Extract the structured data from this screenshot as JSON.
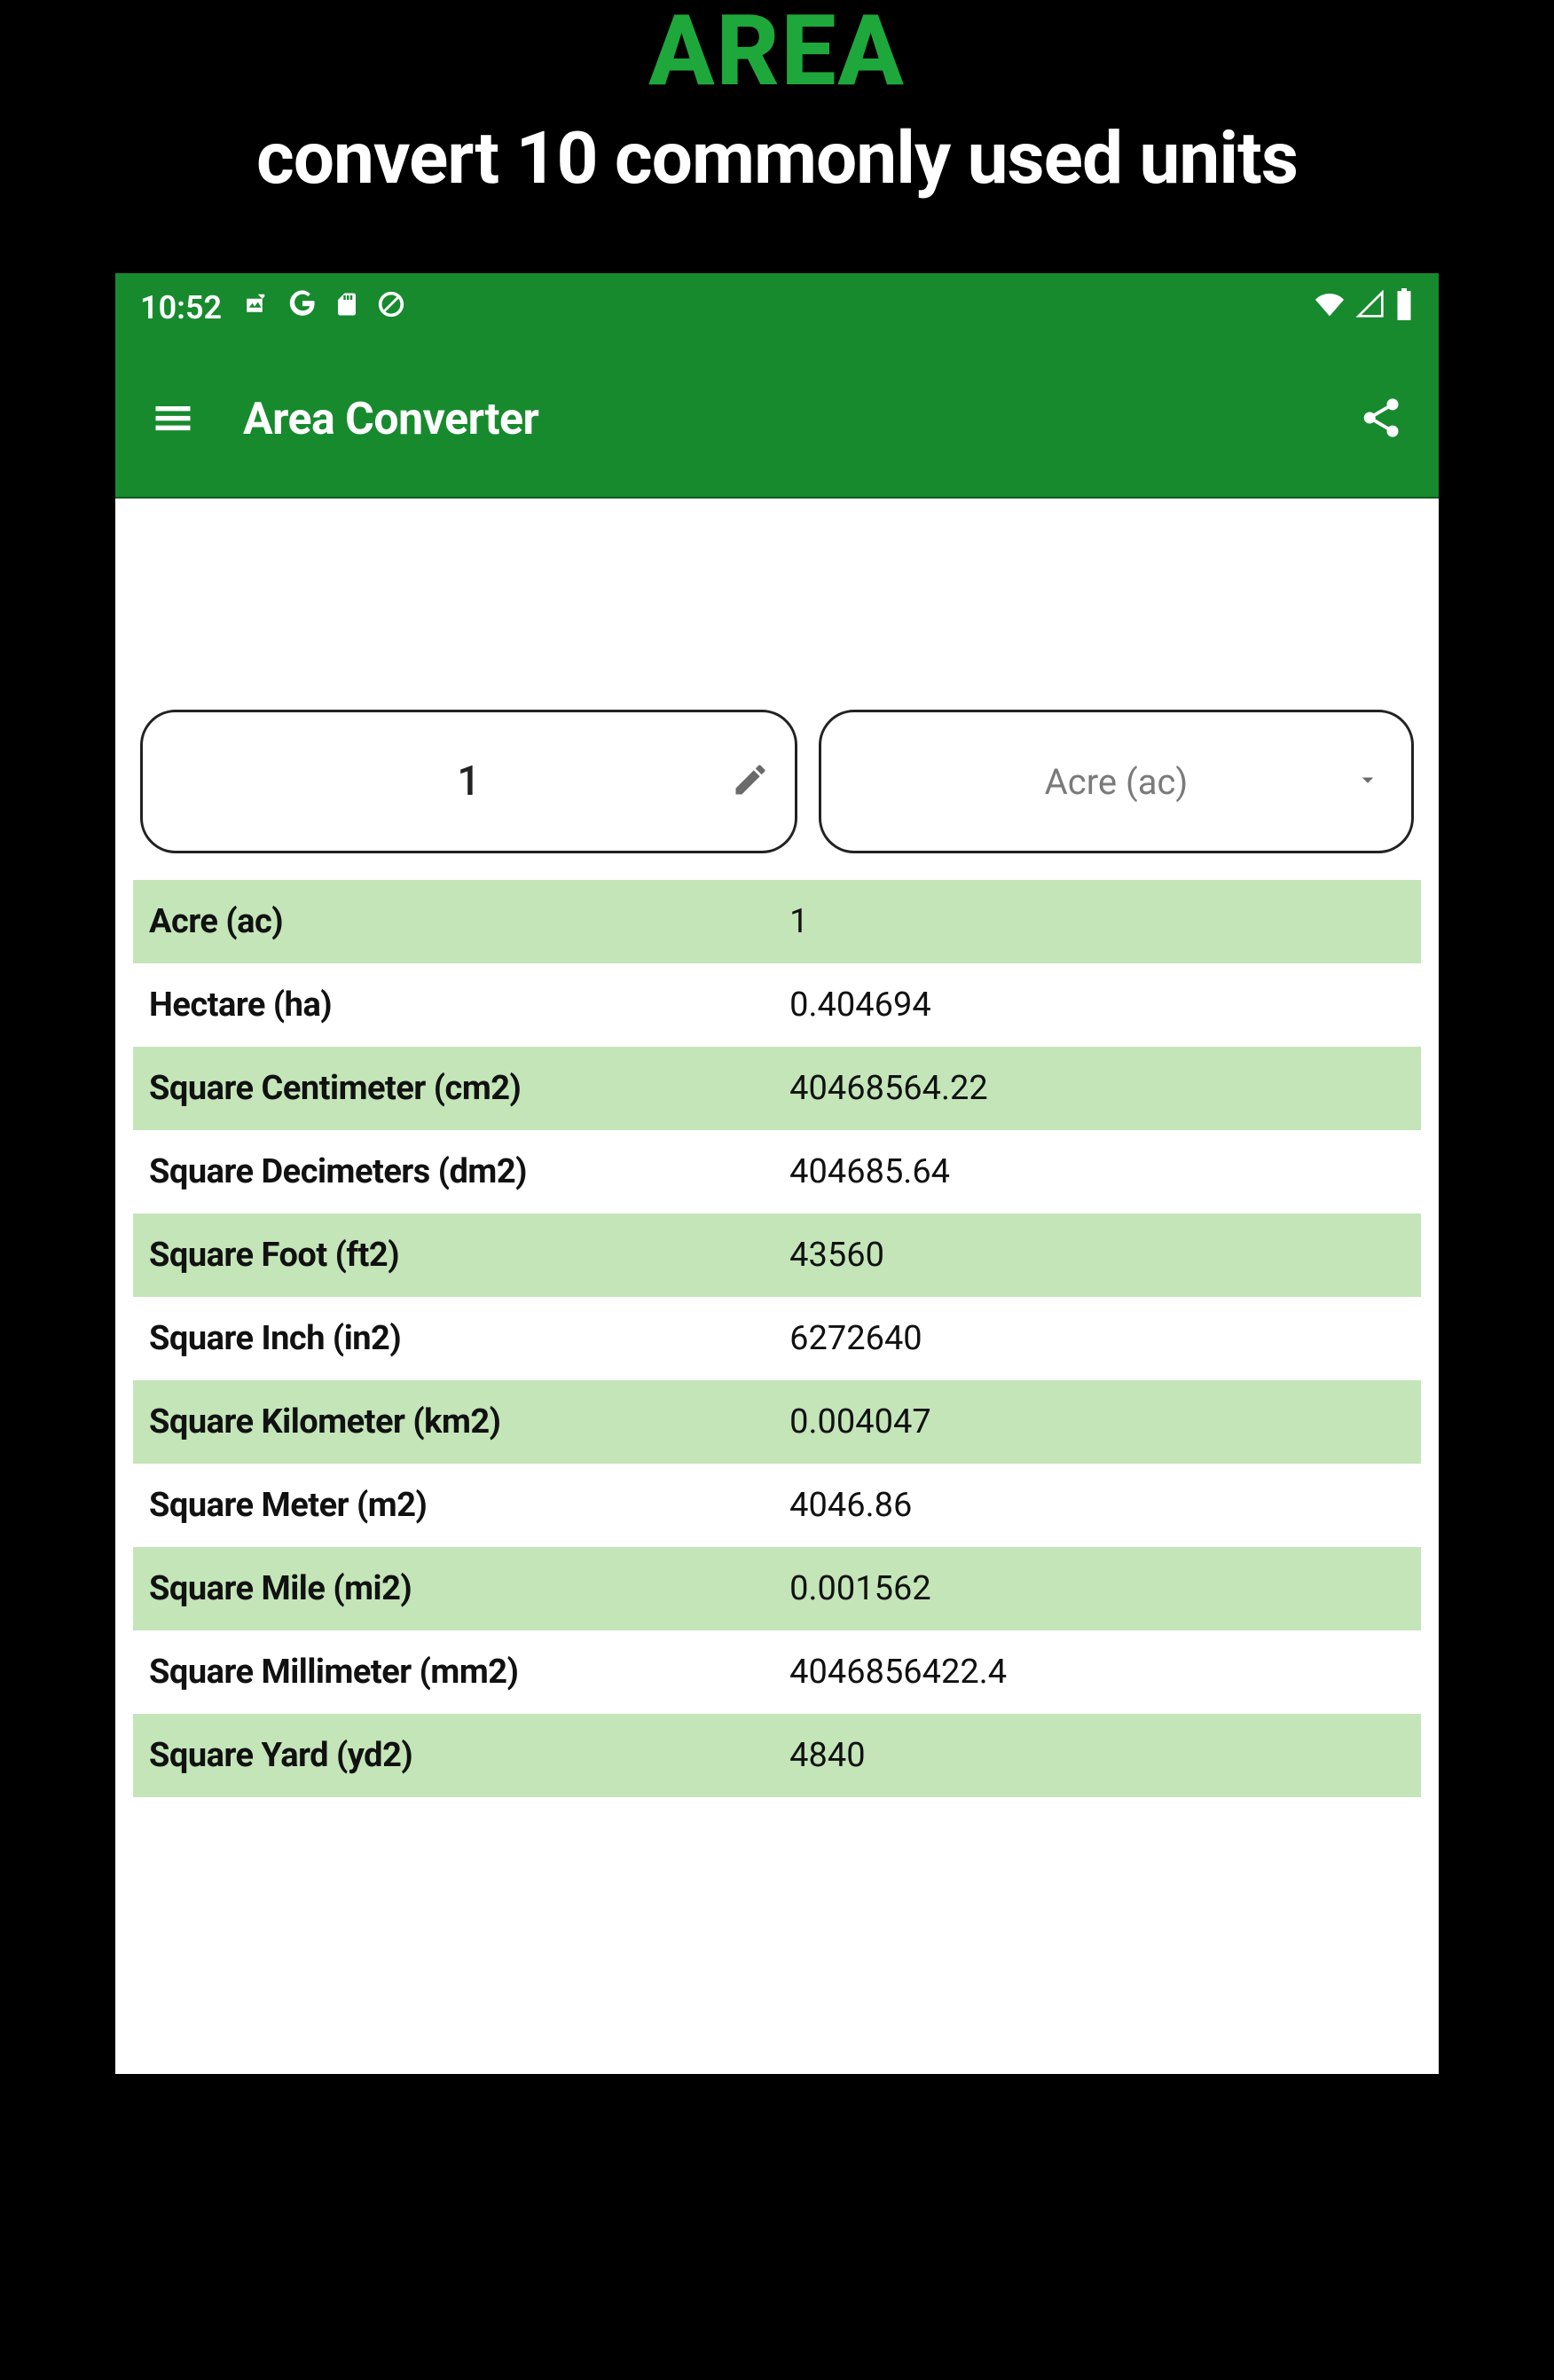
{
  "promo": {
    "title": "AREA",
    "subtitle": "convert 10 commonly used units"
  },
  "statusbar": {
    "clock": "10:52"
  },
  "appbar": {
    "title": "Area Converter"
  },
  "input": {
    "value": "1",
    "selected_unit": "Acre (ac)"
  },
  "results": [
    {
      "unit": "Acre (ac)",
      "value": "1"
    },
    {
      "unit": "Hectare (ha)",
      "value": "0.404694"
    },
    {
      "unit": "Square Centimeter (cm2)",
      "value": "40468564.22"
    },
    {
      "unit": "Square Decimeters (dm2)",
      "value": "404685.64"
    },
    {
      "unit": "Square Foot (ft2)",
      "value": "43560"
    },
    {
      "unit": "Square Inch (in2)",
      "value": "6272640"
    },
    {
      "unit": "Square Kilometer (km2)",
      "value": "0.004047"
    },
    {
      "unit": "Square Meter (m2)",
      "value": "4046.86"
    },
    {
      "unit": "Square Mile (mi2)",
      "value": "0.001562"
    },
    {
      "unit": "Square Millimeter (mm2)",
      "value": "4046856422.4"
    },
    {
      "unit": "Square Yard (yd2)",
      "value": "4840"
    }
  ]
}
